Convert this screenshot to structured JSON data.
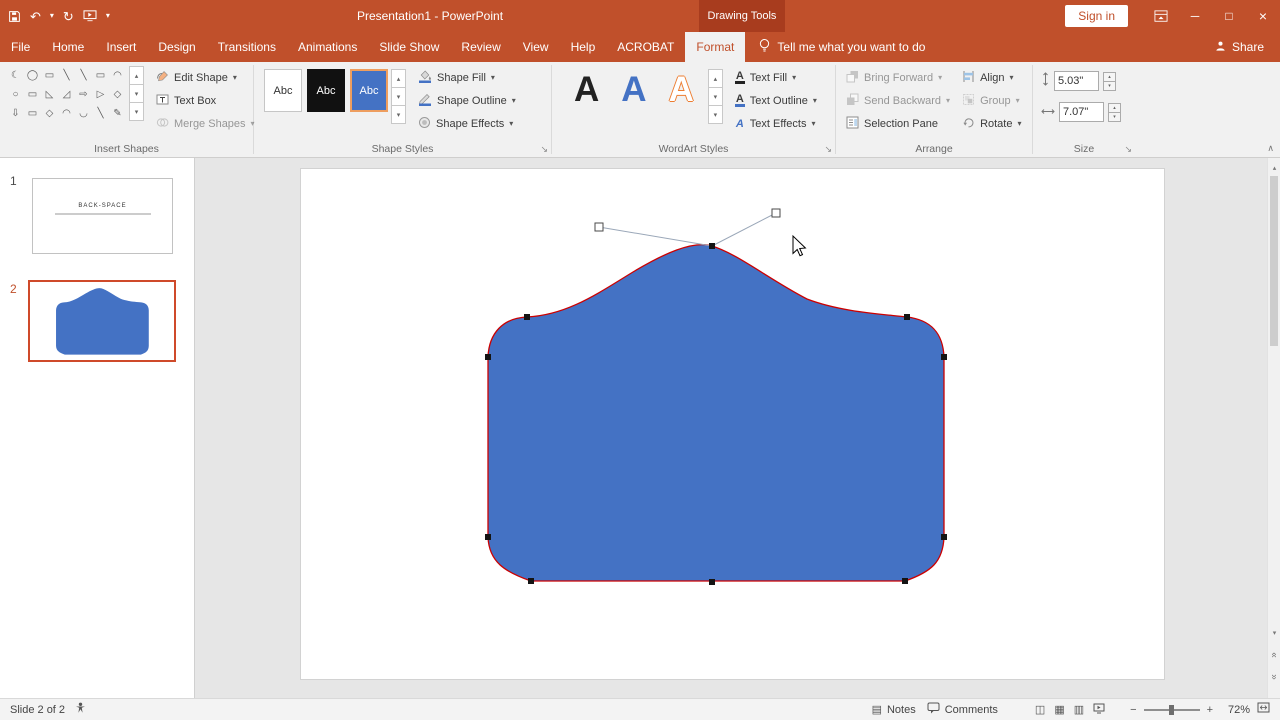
{
  "colors": {
    "titlebar": "#c0502b",
    "contextual_header": "#a83c1e",
    "shape_fill": "#4472c4",
    "shape_outline": "#cc0000",
    "selected_slide_border": "#cf4a2a"
  },
  "title_bar": {
    "title": "Presentation1 - PowerPoint",
    "contextual_header": "Drawing Tools",
    "sign_in_label": "Sign in"
  },
  "tabs": {
    "items": [
      "File",
      "Home",
      "Insert",
      "Design",
      "Transitions",
      "Animations",
      "Slide Show",
      "Review",
      "View",
      "Help",
      "ACROBAT",
      "Format"
    ],
    "active_tab": "Format",
    "tell_me_label": "Tell me what you want to do",
    "share_label": "Share"
  },
  "ribbon": {
    "insert_shapes": {
      "label": "Insert Shapes",
      "glyphs": [
        "☾",
        "◯",
        "▭",
        "╲",
        "╲",
        "▭",
        "◠",
        "○",
        "▭",
        "◺",
        "◿",
        "⇨",
        "▷",
        "◇",
        "⇩",
        "▭",
        "◇",
        "◠",
        "◡",
        "╲",
        "✎"
      ],
      "edit_shape_label": "Edit Shape",
      "text_box_label": "Text Box",
      "merge_shapes_label": "Merge Shapes"
    },
    "shape_styles": {
      "label": "Shape Styles",
      "thumb_text": "Abc",
      "shape_fill_label": "Shape Fill",
      "shape_outline_label": "Shape Outline",
      "shape_effects_label": "Shape Effects"
    },
    "wordart_styles": {
      "label": "WordArt Styles",
      "letter": "A",
      "text_fill_label": "Text Fill",
      "text_outline_label": "Text Outline",
      "text_effects_label": "Text Effects"
    },
    "arrange": {
      "label": "Arrange",
      "bring_forward_label": "Bring Forward",
      "send_backward_label": "Send Backward",
      "selection_pane_label": "Selection Pane",
      "align_label": "Align",
      "group_label": "Group",
      "rotate_label": "Rotate"
    },
    "size": {
      "label": "Size",
      "height_value": "5.03\"",
      "width_value": "7.07\""
    }
  },
  "slides_panel": {
    "slides": [
      {
        "number": "1",
        "title": "BACK-SPACE"
      },
      {
        "number": "2",
        "title": ""
      }
    ]
  },
  "status_bar": {
    "slide_indicator": "Slide 2 of 2",
    "notes_label": "Notes",
    "comments_label": "Comments",
    "zoom_level": "72%"
  },
  "icons": {
    "undo": "↶",
    "repeat": "↻",
    "caret": "▾",
    "scroll_up": "▴",
    "scroll_down": "▾",
    "more": "▾",
    "minimize": "─",
    "maximize": "□",
    "close": "×",
    "notes": "▤",
    "view_normal": "◫",
    "view_sorter": "▦",
    "view_reading": "▥",
    "zoom_out": "−",
    "zoom_in": "+",
    "prev": "«",
    "next": "»",
    "launcher": "↘",
    "collapse": "∧",
    "letter_a": "A"
  }
}
